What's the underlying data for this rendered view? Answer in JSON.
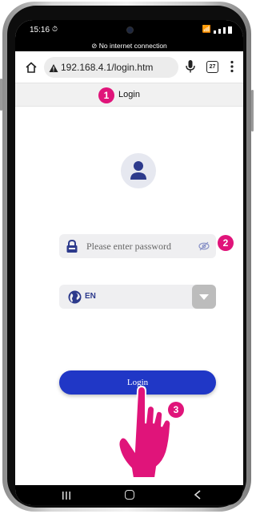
{
  "status_bar": {
    "time": "15:16"
  },
  "banner": {
    "text": "No internet connection"
  },
  "browser": {
    "url": "192.168.4.1/login.htm",
    "tab_count": "27"
  },
  "page": {
    "title": "Login"
  },
  "form": {
    "password_placeholder": "Please enter password",
    "language_value": "EN",
    "login_label": "Login"
  },
  "annotations": {
    "step1": "1",
    "step2": "2",
    "step3": "3"
  },
  "icons": {
    "home": "home-icon",
    "warning": "warning-icon",
    "mic": "mic-icon",
    "tabs": "tabs-icon",
    "menu": "more-vert-icon",
    "user": "user-icon",
    "lock": "lock-icon",
    "eye": "eye-icon",
    "globe": "globe-icon",
    "chevron": "chevron-down-icon",
    "hand": "pointing-hand-icon"
  },
  "colors": {
    "accent": "#2037c6",
    "badge": "#e0147a",
    "hand": "#e0147a",
    "icon_blue": "#2d3a8c"
  }
}
